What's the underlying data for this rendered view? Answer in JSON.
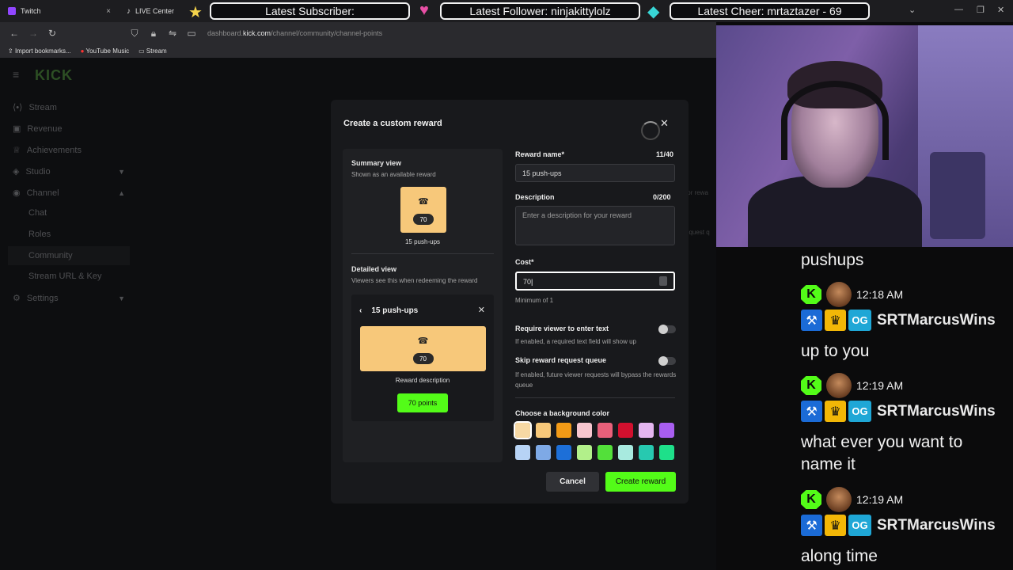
{
  "browser": {
    "tabs": [
      {
        "label": "Twitch"
      },
      {
        "label": "LIVE Center"
      }
    ],
    "url": {
      "prefix": "dashboard.",
      "domain": "kick.com",
      "path": "/channel/community/channel-points"
    },
    "bookmarks": [
      {
        "label": "Import bookmarks..."
      },
      {
        "label": "YouTube Music"
      },
      {
        "label": "Stream"
      }
    ]
  },
  "stream_overlay": {
    "latest_subscriber": "Latest Subscriber:",
    "latest_follower": "Latest Follower: ninjakittylolz",
    "latest_cheer": "Latest Cheer: mrtaztazer - 69"
  },
  "sidebar": {
    "logo": "KICK",
    "items": [
      {
        "label": "Stream",
        "icon": "stream-icon"
      },
      {
        "label": "Revenue",
        "icon": "revenue-icon"
      },
      {
        "label": "Achievements",
        "icon": "trophy-icon"
      },
      {
        "label": "Studio",
        "icon": "studio-icon"
      },
      {
        "label": "Channel",
        "icon": "channel-icon"
      },
      {
        "label": "Chat"
      },
      {
        "label": "Roles"
      },
      {
        "label": "Community"
      },
      {
        "label": "Stream URL & Key"
      },
      {
        "label": "Settings",
        "icon": "gear-icon"
      }
    ]
  },
  "background_hints": [
    "for rewa",
    "equest q"
  ],
  "modal": {
    "title": "Create a custom reward",
    "summary": {
      "heading": "Summary view",
      "subtitle": "Shown as an available reward",
      "cost": "70",
      "name": "15 push-ups"
    },
    "detail": {
      "heading": "Detailed view",
      "subtitle": "Viewers see this when redeeming the reward",
      "title": "15 push-ups",
      "cost": "70",
      "description": "Reward description",
      "points_button": "70 points"
    },
    "reward_name": {
      "label": "Reward name*",
      "counter": "11/40",
      "value": "15 push-ups"
    },
    "description": {
      "label": "Description",
      "counter": "0/200",
      "placeholder": "Enter a description for your reward"
    },
    "cost": {
      "label": "Cost*",
      "value": "70",
      "hint": "Minimum of 1"
    },
    "require_text": {
      "label": "Require viewer to enter text",
      "hint": "If enabled, a required text field will show up",
      "enabled": false
    },
    "skip_queue": {
      "label": "Skip reward request queue",
      "hint": "If enabled, future viewer requests will bypass the rewards queue",
      "enabled": false
    },
    "background_color": {
      "label": "Choose a background color",
      "swatches": [
        "#f7d9a4",
        "#f7c87a",
        "#f29a16",
        "#f7c6cf",
        "#e8607a",
        "#d1102e",
        "#e4b6f0",
        "#a85ef0",
        "#b7d3f5",
        "#7ea9e6",
        "#1d6fd8",
        "#b2f08a",
        "#53e03a",
        "#a8eadf",
        "#27c9b0",
        "#1ee08a"
      ],
      "selected": 0
    },
    "cancel": "Cancel",
    "create": "Create reward"
  },
  "chat": {
    "messages": [
      {
        "text": "pushups"
      },
      {
        "time": "12:18 AM",
        "user": "SRTMarcusWins",
        "text": "up to you"
      },
      {
        "time": "12:19 AM",
        "user": "SRTMarcusWins",
        "text": "what ever you want to",
        "text2": "name it"
      },
      {
        "time": "12:19 AM",
        "user": "SRTMarcusWins",
        "text": "along time"
      }
    ],
    "badge_k": "K",
    "badge_og": "OG"
  }
}
